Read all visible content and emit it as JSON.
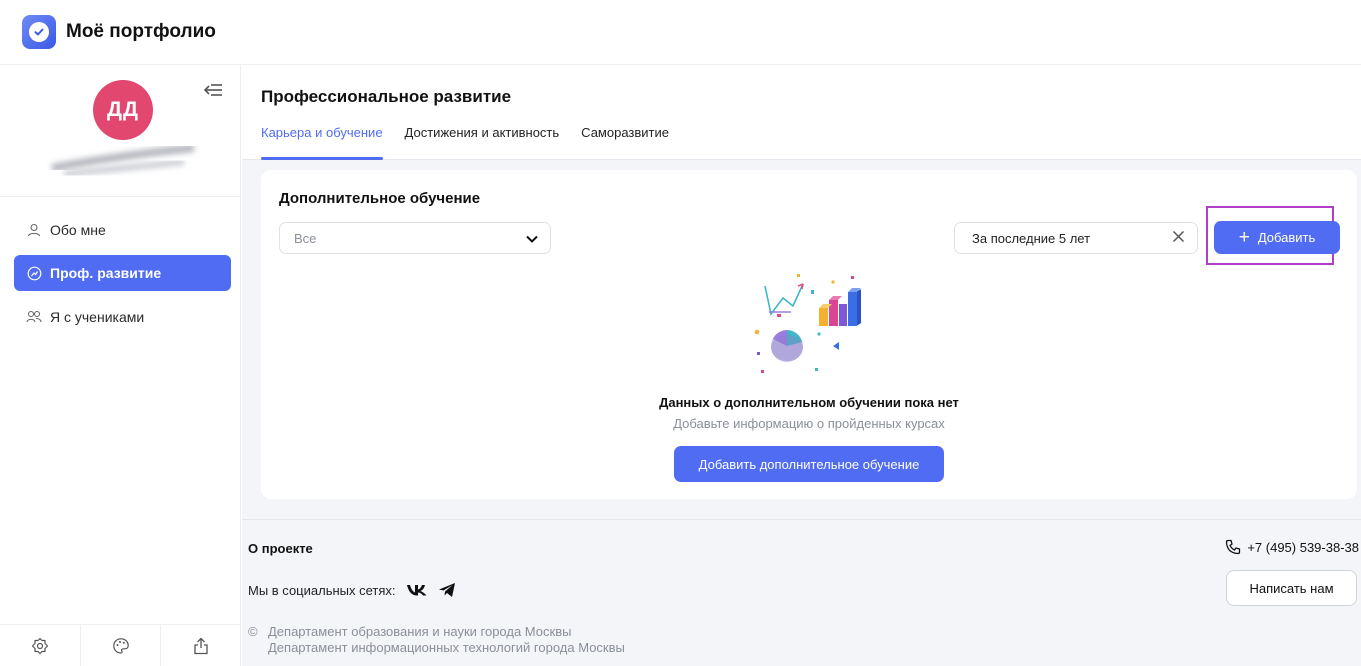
{
  "app": {
    "title": "Моё портфолио"
  },
  "user": {
    "initials": "ДД"
  },
  "sidebar": {
    "items": [
      {
        "label": "Обо мне",
        "icon": "user-icon",
        "active": false
      },
      {
        "label": "Проф. развитие",
        "icon": "growth-icon",
        "active": true
      },
      {
        "label": "Я с учениками",
        "icon": "users-icon",
        "active": false
      }
    ],
    "bottom_icons": [
      "settings-icon",
      "palette-icon",
      "share-icon"
    ]
  },
  "header": {
    "title": "Профессиональное развитие",
    "tabs": [
      {
        "label": "Карьера и обучение",
        "active": true
      },
      {
        "label": "Достижения и активность",
        "active": false
      },
      {
        "label": "Саморазвитие",
        "active": false
      }
    ]
  },
  "section": {
    "title": "Дополнительное обучение",
    "filter_select": "Все",
    "period_filter": "За последние 5 лет",
    "add_button": "Добавить",
    "empty_title": "Данных о дополнительном обучении пока нет",
    "empty_subtitle": "Добавьте информацию о пройденных курсах",
    "add_edu_button": "Добавить дополнительное обучение"
  },
  "footer": {
    "about": "О проекте",
    "social_label": "Мы в социальных сетях:",
    "phone": "+7 (495) 539-38-38",
    "write_button": "Написать нам",
    "copyright_line1": "Департамент образования и науки города Москвы",
    "copyright_line2": "Департамент информационных технологий города Москвы",
    "copyright_sign": "©"
  },
  "colors": {
    "accent": "#4f6cf2",
    "avatar": "#e2476f",
    "highlight": "#b03ec8",
    "background": "#f4f5f8"
  }
}
